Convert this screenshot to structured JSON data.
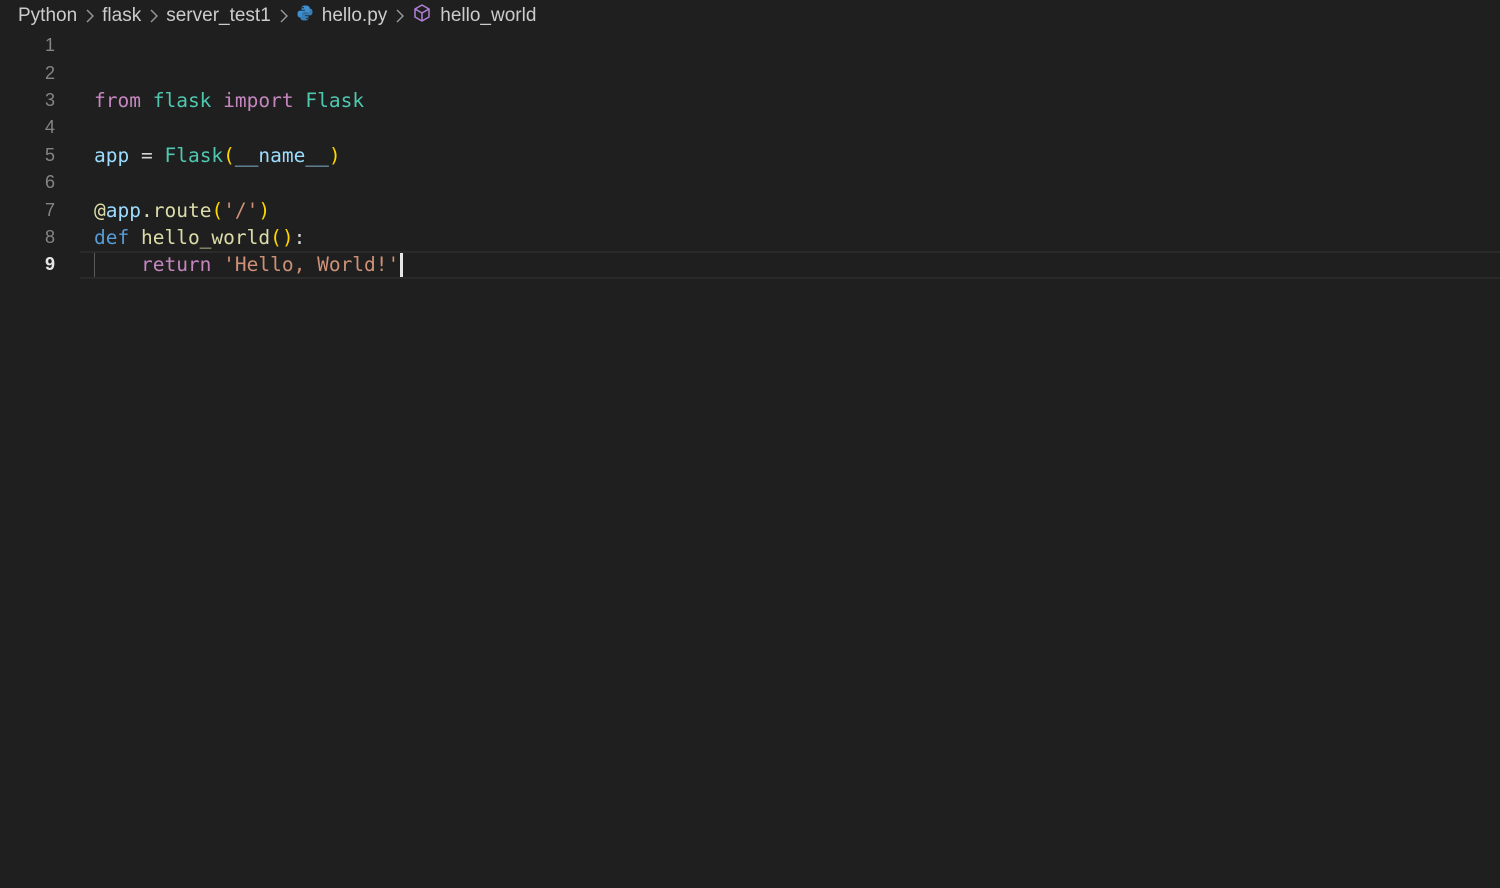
{
  "breadcrumbs": {
    "items": [
      {
        "label": "Python",
        "icon": ""
      },
      {
        "label": "flask",
        "icon": ""
      },
      {
        "label": "server_test1",
        "icon": ""
      },
      {
        "label": "hello.py",
        "icon": "python-file-icon"
      },
      {
        "label": "hello_world",
        "icon": "symbol-method-icon"
      }
    ]
  },
  "colors": {
    "background": "#1f1f1f",
    "keyword_control": "#c586c0",
    "keyword_storage": "#569cd6",
    "module_class": "#4ec9b0",
    "variable": "#9cdcfe",
    "function": "#dcdcaa",
    "string": "#ce9178",
    "bracket": "#ffd700",
    "plain": "#d4d4d4"
  },
  "editor": {
    "current_line": 9,
    "lines": [
      {
        "number": "1",
        "tokens": []
      },
      {
        "number": "2",
        "tokens": []
      },
      {
        "number": "3",
        "tokens": [
          {
            "text": "from",
            "color": "#c586c0"
          },
          {
            "text": " ",
            "color": "#d4d4d4"
          },
          {
            "text": "flask",
            "color": "#4ec9b0"
          },
          {
            "text": " ",
            "color": "#d4d4d4"
          },
          {
            "text": "import",
            "color": "#c586c0"
          },
          {
            "text": " ",
            "color": "#d4d4d4"
          },
          {
            "text": "Flask",
            "color": "#4ec9b0"
          }
        ]
      },
      {
        "number": "4",
        "tokens": []
      },
      {
        "number": "5",
        "tokens": [
          {
            "text": "app",
            "color": "#9cdcfe"
          },
          {
            "text": " = ",
            "color": "#d4d4d4"
          },
          {
            "text": "Flask",
            "color": "#4ec9b0"
          },
          {
            "text": "(",
            "color": "#ffd700"
          },
          {
            "text": "__name__",
            "color": "#9cdcfe"
          },
          {
            "text": ")",
            "color": "#ffd700"
          }
        ]
      },
      {
        "number": "6",
        "tokens": []
      },
      {
        "number": "7",
        "tokens": [
          {
            "text": "@",
            "color": "#dcdcaa"
          },
          {
            "text": "app",
            "color": "#9cdcfe"
          },
          {
            "text": ".",
            "color": "#dcdcaa"
          },
          {
            "text": "route",
            "color": "#dcdcaa"
          },
          {
            "text": "(",
            "color": "#ffd700"
          },
          {
            "text": "'/'",
            "color": "#ce9178"
          },
          {
            "text": ")",
            "color": "#ffd700"
          }
        ]
      },
      {
        "number": "8",
        "tokens": [
          {
            "text": "def",
            "color": "#569cd6"
          },
          {
            "text": " ",
            "color": "#d4d4d4"
          },
          {
            "text": "hello_world",
            "color": "#dcdcaa"
          },
          {
            "text": "()",
            "color": "#ffd700"
          },
          {
            "text": ":",
            "color": "#d4d4d4"
          }
        ]
      },
      {
        "number": "9",
        "indent": "    ",
        "tokens": [
          {
            "text": "return",
            "color": "#c586c0"
          },
          {
            "text": " ",
            "color": "#d4d4d4"
          },
          {
            "text": "'Hello, World!'",
            "color": "#ce9178"
          }
        ]
      }
    ]
  }
}
